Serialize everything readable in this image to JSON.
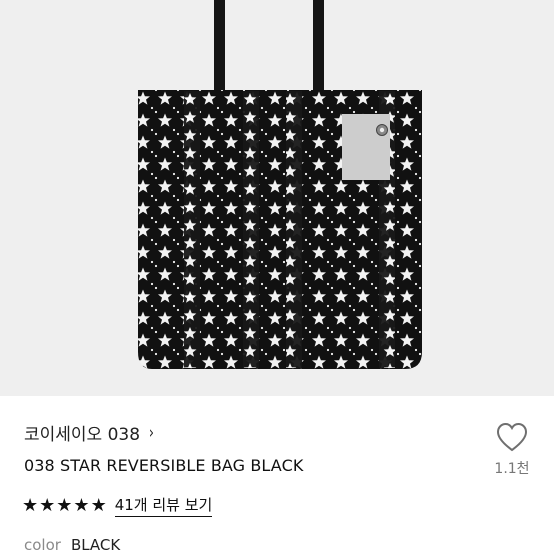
{
  "product_image": {
    "alt_semantic": "product-photo",
    "background_color": "#efefef",
    "bag_color": "#111111",
    "pattern_color": "#f2f2f2",
    "label_color": "#cfcfcf"
  },
  "brand": {
    "name": "코이세이오 038",
    "chevron": "›"
  },
  "product": {
    "title": "038 STAR REVERSIBLE BAG BLACK"
  },
  "rating": {
    "stars": 5,
    "star_glyph": "★",
    "review_link": "41개 리뷰 보기"
  },
  "color_option": {
    "label": "color",
    "value": "BLACK"
  },
  "like": {
    "icon": "heart-outline-icon",
    "count": "1.1천"
  }
}
